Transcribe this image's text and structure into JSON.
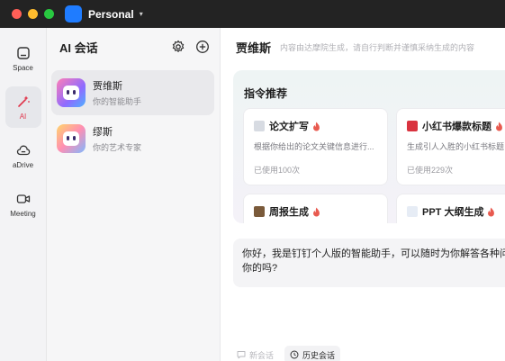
{
  "titlebar": {
    "org_name": "Personal",
    "org_caret": "▾"
  },
  "rail": {
    "items": [
      {
        "label": "Space",
        "icon": "space-icon"
      },
      {
        "label": "AI",
        "icon": "ai-wand-icon",
        "active": true
      },
      {
        "label": "aDrive",
        "icon": "cloud-drive-icon"
      },
      {
        "label": "Meeting",
        "icon": "video-camera-icon"
      }
    ]
  },
  "conversations": {
    "title": "AI 会话",
    "items": [
      {
        "name": "贾维斯",
        "subtitle": "你的智能助手",
        "active": true
      },
      {
        "name": "缪斯",
        "subtitle": "你的艺术专家",
        "active": false
      }
    ]
  },
  "main": {
    "title": "贾维斯",
    "disclaimer": "内容由达摩院生成，请自行判断并谨慎采纳生成的内容",
    "commands": {
      "title": "指令推荐",
      "cards": [
        {
          "title": "论文扩写",
          "emoji": "document-icon",
          "desc": "根据你给出的论文关键信息进行...",
          "usage": "已使用100次"
        },
        {
          "title": "小红书爆款标题",
          "emoji": "red-book-icon",
          "desc": "生成引人入胜的小红书标题",
          "usage": "已使用229次"
        },
        {
          "title": "周报生成",
          "emoji": "briefcase-icon",
          "desc": "",
          "usage": ""
        },
        {
          "title": "PPT 大纲生成",
          "emoji": "chart-icon",
          "desc": "",
          "usage": ""
        }
      ]
    },
    "greeting_line1": "你好，我是钉钉个人版的智能助手，可以随时为你解答各种问",
    "greeting_line2": "你的吗?",
    "footer": {
      "new_chat": "新会话",
      "history": "历史会话"
    }
  },
  "colors": {
    "accent": "#e0344a",
    "brand_blue": "#1f7cff"
  }
}
